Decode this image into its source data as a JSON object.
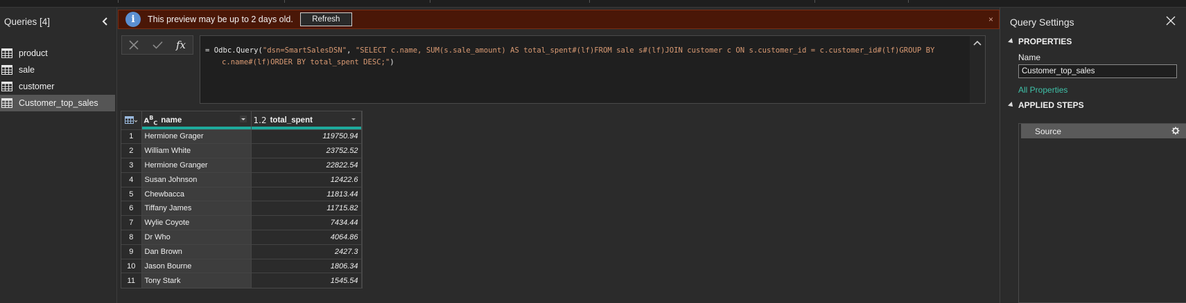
{
  "queries_pane": {
    "title": "Queries [4]",
    "items": [
      {
        "label": "product",
        "selected": false
      },
      {
        "label": "sale",
        "selected": false
      },
      {
        "label": "customer",
        "selected": false
      },
      {
        "label": "Customer_top_sales",
        "selected": true
      }
    ]
  },
  "banner": {
    "message": "This preview may be up to 2 days old.",
    "refresh_label": "Refresh",
    "close_glyph": "×"
  },
  "formula": {
    "fx_label": "fx",
    "prefix": "= Odbc.Query(",
    "arg1": "\"dsn=SmartSalesDSN\"",
    "sep": ", ",
    "arg2_line1": "\"SELECT c.name, SUM(s.sale_amount) AS total_spent#(lf)FROM sale s#(lf)JOIN customer c ON s.customer_id = c.customer_id#(lf)GROUP BY",
    "arg2_line2": "c.name#(lf)ORDER BY total_spent DESC;\"",
    "suffix": ")"
  },
  "grid": {
    "columns": [
      {
        "name": "name",
        "type_label": "ABC"
      },
      {
        "name": "total_spent",
        "type_label": "1.2"
      }
    ],
    "rows": [
      {
        "n": "1",
        "name": "Hermione Grager",
        "total_spent": "119750.94"
      },
      {
        "n": "2",
        "name": "William White",
        "total_spent": "23752.52"
      },
      {
        "n": "3",
        "name": "Hermione Granger",
        "total_spent": "22822.54"
      },
      {
        "n": "4",
        "name": "Susan Johnson",
        "total_spent": "12422.6"
      },
      {
        "n": "5",
        "name": "Chewbacca",
        "total_spent": "11813.44"
      },
      {
        "n": "6",
        "name": "Tiffany James",
        "total_spent": "11715.82"
      },
      {
        "n": "7",
        "name": "Wylie Coyote",
        "total_spent": "7434.44"
      },
      {
        "n": "8",
        "name": "Dr Who",
        "total_spent": "4064.86"
      },
      {
        "n": "9",
        "name": "Dan Brown",
        "total_spent": "2427.3"
      },
      {
        "n": "10",
        "name": "Jason Bourne",
        "total_spent": "1806.34"
      },
      {
        "n": "11",
        "name": "Tony Stark",
        "total_spent": "1545.54"
      }
    ]
  },
  "settings": {
    "title": "Query Settings",
    "properties_heading": "PROPERTIES",
    "name_label": "Name",
    "name_value": "Customer_top_sales",
    "all_properties_link": "All Properties",
    "applied_steps_heading": "APPLIED STEPS",
    "steps": [
      {
        "label": "Source"
      }
    ]
  },
  "colors": {
    "accent_teal": "#1eaa9c",
    "link_green": "#3fc1a8",
    "banner_bg": "#4a1707",
    "info_blue": "#5b8fd1",
    "string_orange": "#d99a73"
  }
}
